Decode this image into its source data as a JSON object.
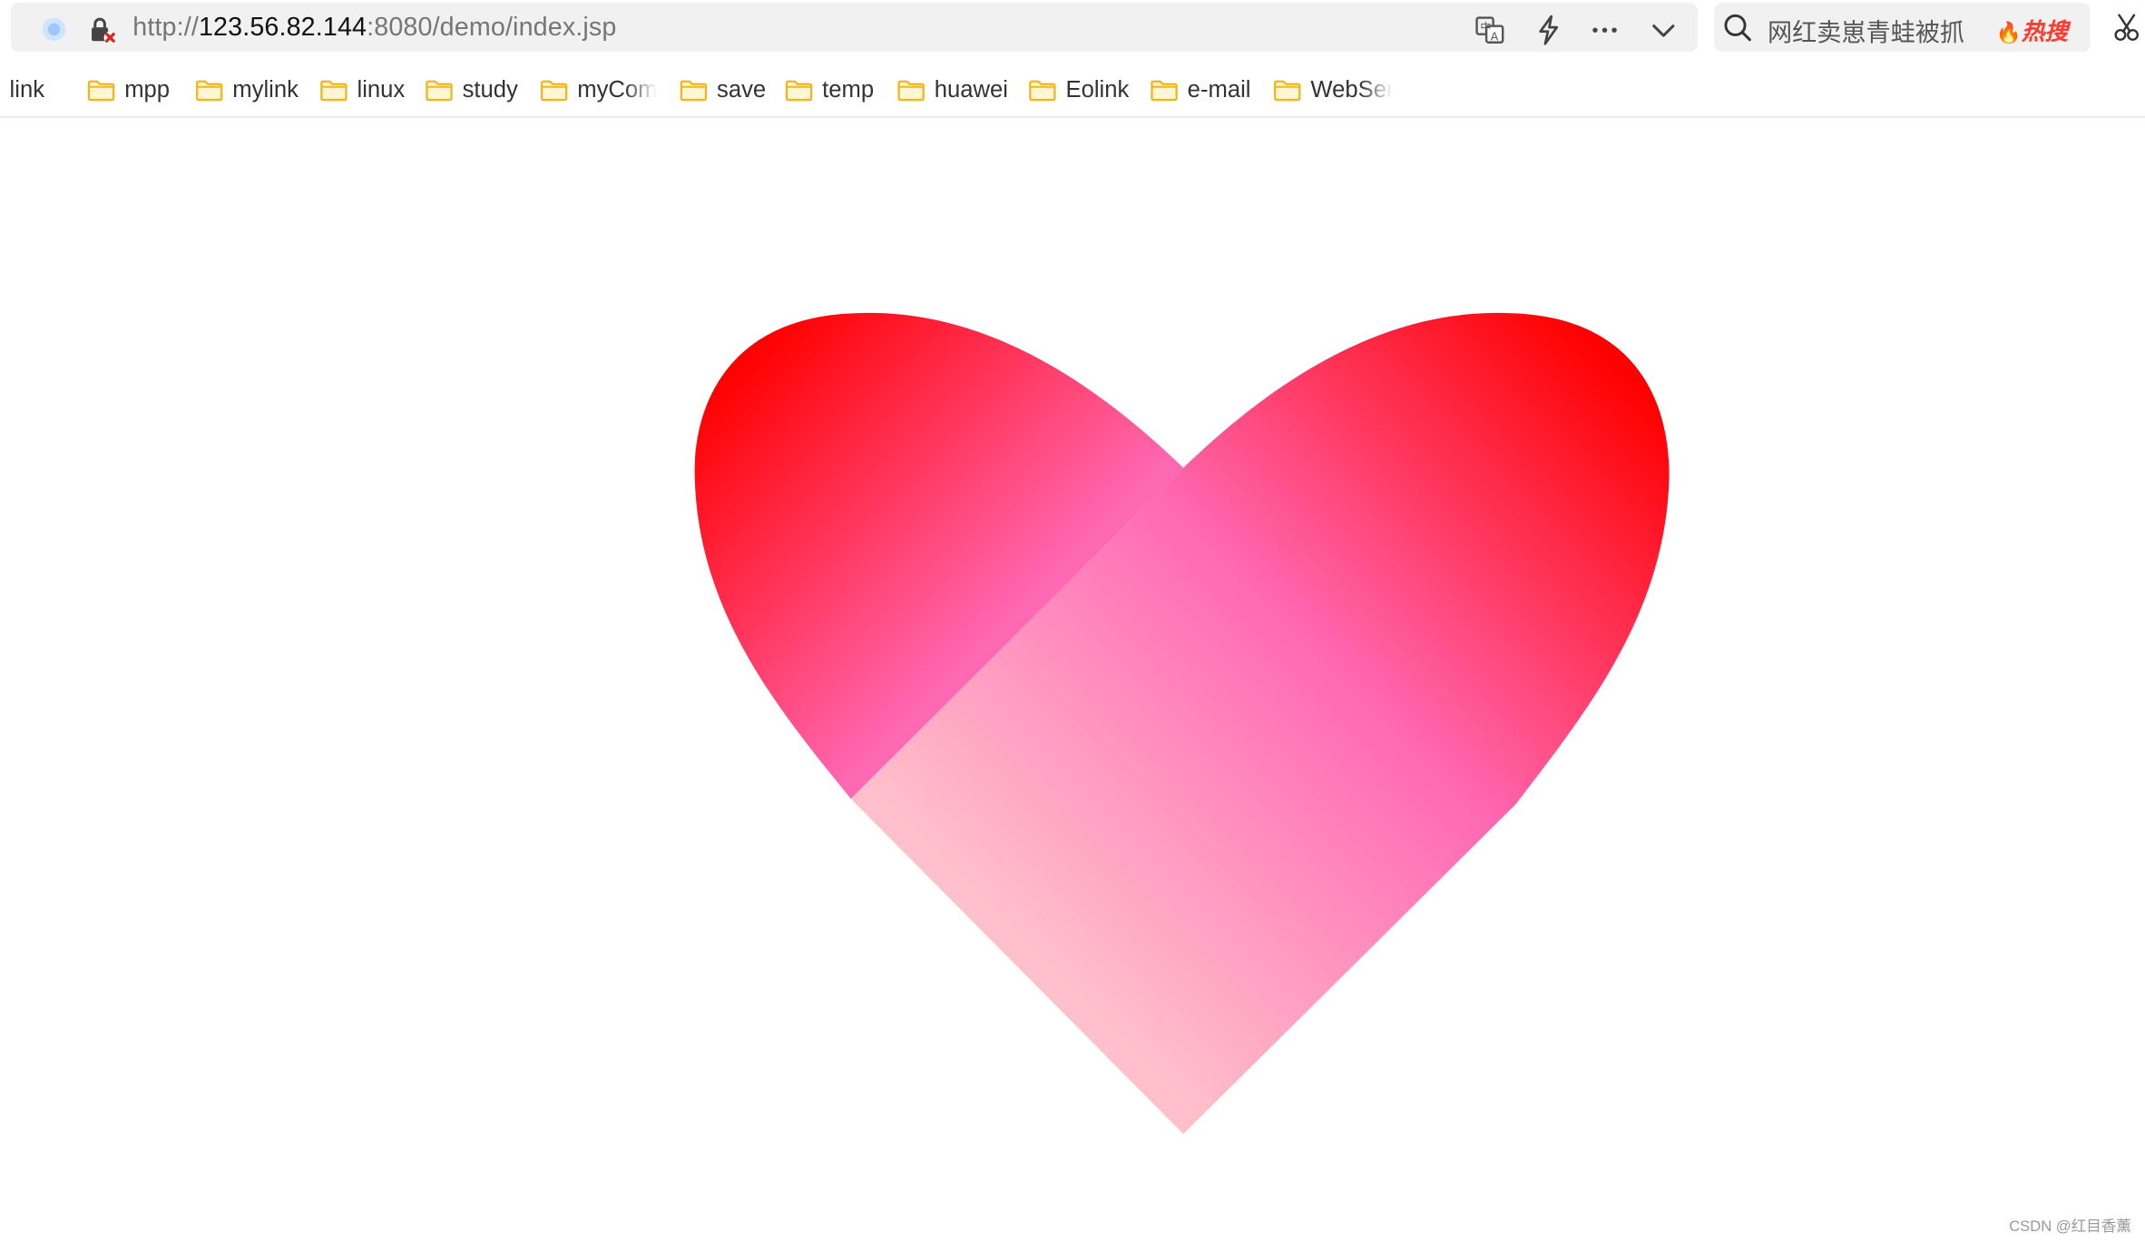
{
  "address_bar": {
    "url_prefix": "http://",
    "url_host": "123.56.82.144",
    "url_rest": ":8080/demo/index.jsp"
  },
  "search": {
    "text": "网红卖崽青蛙被抓",
    "hot_label": "热搜"
  },
  "bookmarks": [
    {
      "label": "link"
    },
    {
      "label": "mpp"
    },
    {
      "label": "mylink"
    },
    {
      "label": "linux"
    },
    {
      "label": "study"
    },
    {
      "label": "myCom"
    },
    {
      "label": "save"
    },
    {
      "label": "temp"
    },
    {
      "label": "huawei"
    },
    {
      "label": "Eolink"
    },
    {
      "label": "e-mail"
    },
    {
      "label": "WebSer"
    }
  ],
  "page": {
    "heart_colors": {
      "red": "#ff0000",
      "hot_pink": "#ff69b4",
      "light_pink": "#ffc0cb"
    }
  },
  "watermark": "CSDN @红目香薰",
  "icons": {
    "site": "site-identity-icon",
    "lock": "insecure-lock-icon",
    "translate": "translate-icon",
    "lightning": "lightning-icon",
    "more": "more-icon",
    "dropdown": "chevron-down-icon",
    "search": "search-icon",
    "flame": "flame-icon",
    "scissors": "scissors-icon",
    "folder": "folder-icon"
  }
}
